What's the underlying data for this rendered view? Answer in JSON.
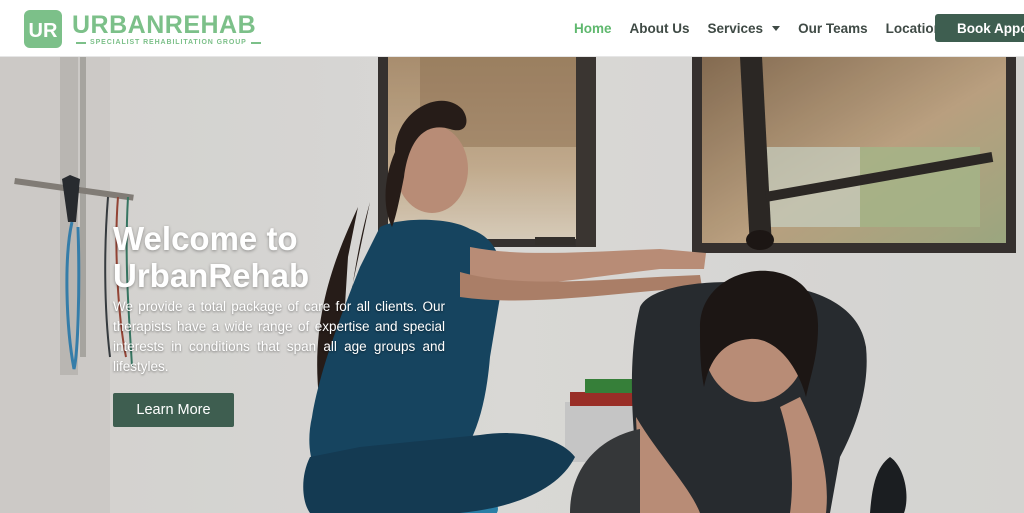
{
  "brand": {
    "logo_initials": "UR",
    "name": "URBANREHAB",
    "tagline": "SPECIALIST REHABILITATION GROUP",
    "color": "#7cc089"
  },
  "nav": {
    "items": [
      {
        "label": "Home",
        "active": true
      },
      {
        "label": "About Us"
      },
      {
        "label": "Services",
        "has_dropdown": true
      },
      {
        "label": "Our Teams"
      },
      {
        "label": "Locations"
      }
    ],
    "book_button": "Book Appoi",
    "active_color": "#5fb86e",
    "button_color": "#3e5e50"
  },
  "hero": {
    "title_line1": "Welcome to",
    "title_line2": "UrbanRehab",
    "description": "We provide a total package of care for all clients. Our therapists have a wide range of expertise and special interests in conditions that span all age groups and lifestyles.",
    "cta_label": "Learn More"
  }
}
